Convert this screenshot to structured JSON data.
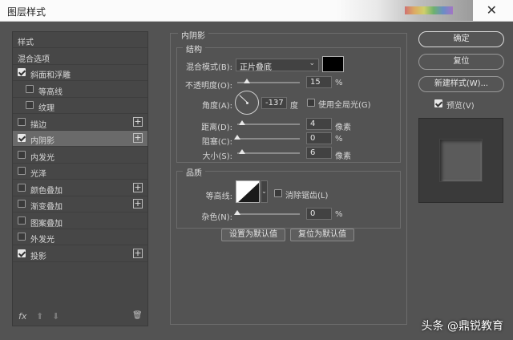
{
  "window": {
    "title": "图层样式",
    "close_glyph": "✕"
  },
  "left_panel": {
    "items": [
      {
        "label": "样式",
        "checkbox": false,
        "checked": false,
        "plus": false,
        "indent": 0,
        "active": false
      },
      {
        "label": "混合选项",
        "checkbox": false,
        "checked": false,
        "plus": false,
        "indent": 0,
        "active": false
      },
      {
        "label": "斜面和浮雕",
        "checkbox": true,
        "checked": true,
        "plus": false,
        "indent": 0,
        "active": false
      },
      {
        "label": "等高线",
        "checkbox": true,
        "checked": false,
        "plus": false,
        "indent": 1,
        "active": false
      },
      {
        "label": "纹理",
        "checkbox": true,
        "checked": false,
        "plus": false,
        "indent": 1,
        "active": false
      },
      {
        "label": "描边",
        "checkbox": true,
        "checked": false,
        "plus": true,
        "indent": 0,
        "active": false
      },
      {
        "label": "内阴影",
        "checkbox": true,
        "checked": true,
        "plus": true,
        "indent": 0,
        "active": true
      },
      {
        "label": "内发光",
        "checkbox": true,
        "checked": false,
        "plus": false,
        "indent": 0,
        "active": false
      },
      {
        "label": "光泽",
        "checkbox": true,
        "checked": false,
        "plus": false,
        "indent": 0,
        "active": false
      },
      {
        "label": "颜色叠加",
        "checkbox": true,
        "checked": false,
        "plus": true,
        "indent": 0,
        "active": false
      },
      {
        "label": "渐变叠加",
        "checkbox": true,
        "checked": false,
        "plus": true,
        "indent": 0,
        "active": false
      },
      {
        "label": "图案叠加",
        "checkbox": true,
        "checked": false,
        "plus": false,
        "indent": 0,
        "active": false
      },
      {
        "label": "外发光",
        "checkbox": true,
        "checked": false,
        "plus": false,
        "indent": 0,
        "active": false
      },
      {
        "label": "投影",
        "checkbox": true,
        "checked": true,
        "plus": true,
        "indent": 0,
        "active": false
      }
    ],
    "footer": {
      "fx": "fx",
      "up": "⬆",
      "down": "⬇",
      "trash": "🗑"
    }
  },
  "inner_shadow": {
    "heading": "内阴影",
    "structure": {
      "heading": "结构",
      "blend_mode_label": "混合模式(B):",
      "blend_mode_value": "正片叠底",
      "shadow_color": "#000000",
      "opacity_label": "不透明度(O):",
      "opacity_value": "15",
      "opacity_level": 15,
      "percent_unit": "%",
      "angle_label": "角度(A):",
      "angle_value": "-137",
      "angle_unit": "度",
      "global_light_label": "使用全局光(G)",
      "global_light_checked": false,
      "distance_label": "距离(D):",
      "distance_value": "4",
      "choke_label": "阻塞(C):",
      "choke_value": "0",
      "size_label": "大小(S):",
      "size_value": "6",
      "pixel_unit": "像素"
    },
    "quality": {
      "heading": "品质",
      "contour_label": "等高线:",
      "antialias_label": "消除锯齿(L)",
      "antialias_checked": false,
      "noise_label": "杂色(N):",
      "noise_value": "0",
      "percent_unit": "%"
    },
    "make_default_label": "设置为默认值",
    "reset_default_label": "复位为默认值"
  },
  "actions": {
    "ok_label": "确定",
    "reset_label": "复位",
    "new_style_label": "新建样式(W)...",
    "preview_label": "预览(V)",
    "preview_checked": true
  },
  "watermark": "头条 @鼎锐教育"
}
